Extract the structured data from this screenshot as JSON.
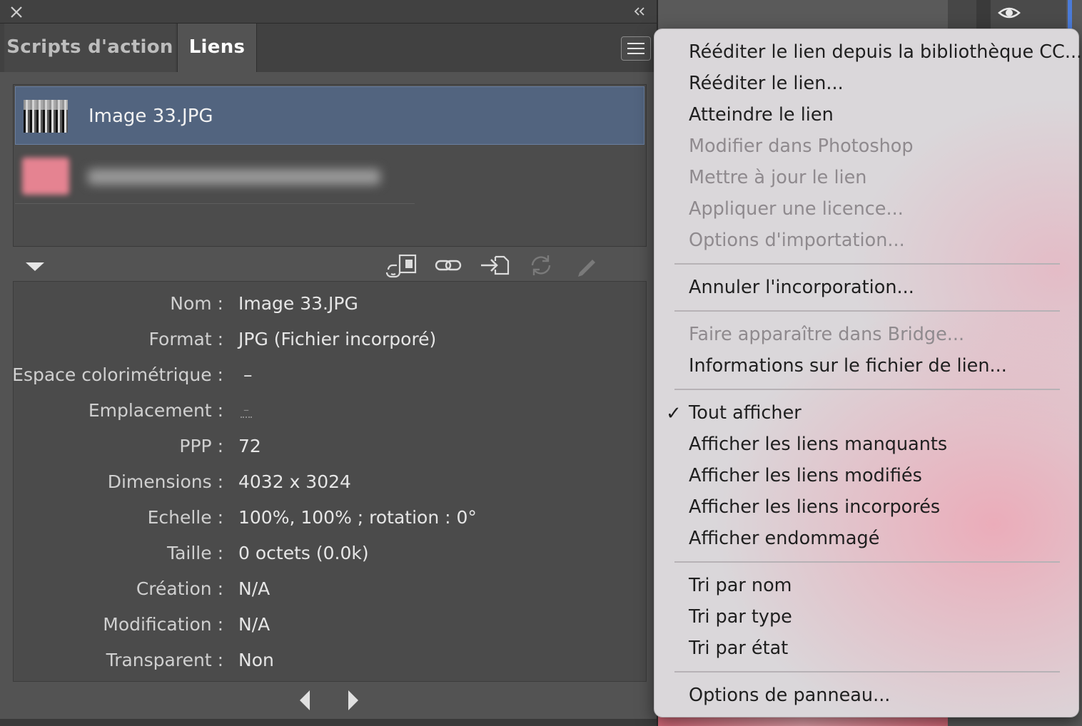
{
  "panel": {
    "tabs": [
      {
        "label": "Scripts d'action",
        "active": false
      },
      {
        "label": "Liens",
        "active": true
      }
    ],
    "links": [
      {
        "name": "Image 33.JPG",
        "selected": true
      },
      {
        "name": "",
        "selected": false,
        "blurred": true
      }
    ],
    "toolbar_icons": [
      "relink-cc-library-icon",
      "relink-icon",
      "goto-link-icon",
      "update-link-icon",
      "edit-original-icon"
    ],
    "info": [
      {
        "label": "Nom :",
        "value": "Image 33.JPG"
      },
      {
        "label": "Format :",
        "value": "JPG (Fichier incorporé)"
      },
      {
        "label": "Espace colorimétrique :",
        "value": "–"
      },
      {
        "label": "Emplacement :",
        "value": "–"
      },
      {
        "label": "PPP :",
        "value": "72"
      },
      {
        "label": "Dimensions :",
        "value": "4032 x 3024"
      },
      {
        "label": "Echelle :",
        "value": "100%, 100% ; rotation : 0°"
      },
      {
        "label": "Taille :",
        "value": "0 octets (0.0k)"
      },
      {
        "label": "Création :",
        "value": "N/A"
      },
      {
        "label": "Modification :",
        "value": "N/A"
      },
      {
        "label": "Transparent :",
        "value": "Non"
      }
    ]
  },
  "menu": {
    "items": [
      {
        "label": "Rééditer le lien depuis la bibliothèque CC...",
        "enabled": true
      },
      {
        "label": "Rééditer le lien...",
        "enabled": true
      },
      {
        "label": "Atteindre le lien",
        "enabled": true
      },
      {
        "label": "Modifier dans Photoshop",
        "enabled": false
      },
      {
        "label": "Mettre à jour le lien",
        "enabled": false
      },
      {
        "label": "Appliquer une licence...",
        "enabled": false
      },
      {
        "label": "Options d'importation...",
        "enabled": false
      },
      {
        "label": "Annuler l'incorporation...",
        "enabled": true
      },
      {
        "label": "Faire apparaître dans Bridge...",
        "enabled": false
      },
      {
        "label": "Informations sur le fichier de lien...",
        "enabled": true
      },
      {
        "label": "Tout afficher",
        "enabled": true,
        "checked": true
      },
      {
        "label": "Afficher les liens manquants",
        "enabled": true
      },
      {
        "label": "Afficher les liens modifiés",
        "enabled": true
      },
      {
        "label": "Afficher les liens incorporés",
        "enabled": true
      },
      {
        "label": "Afficher endommagé",
        "enabled": true
      },
      {
        "label": "Tri par nom",
        "enabled": true
      },
      {
        "label": "Tri par type",
        "enabled": true
      },
      {
        "label": "Tri par état",
        "enabled": true
      },
      {
        "label": "Options de panneau...",
        "enabled": true
      }
    ],
    "check_mark": "✓"
  },
  "colors": {
    "panel_bg": "#535353",
    "selection": "#52647f",
    "menu_bg": "#dad7da",
    "menu_pink": "#ecaab8",
    "disabled_text": "#8f8a8e"
  }
}
